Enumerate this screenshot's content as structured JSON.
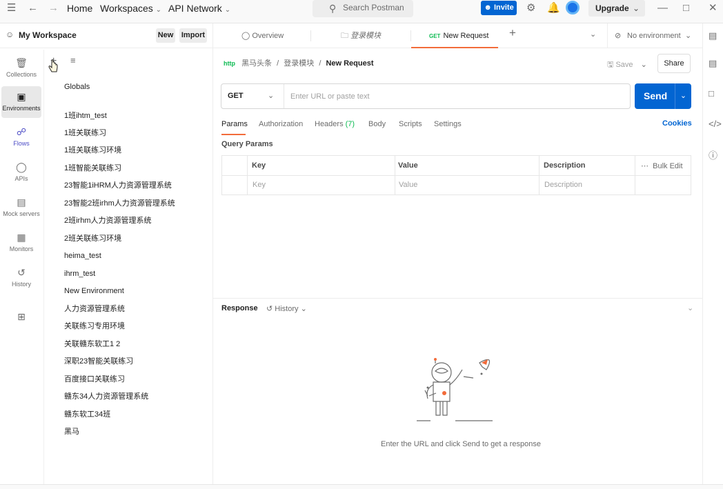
{
  "topbar": {
    "home": "Home",
    "workspaces": "Workspaces",
    "api_network": "API Network",
    "search_placeholder": "Search Postman",
    "invite": "Invite",
    "upgrade": "Upgrade"
  },
  "workspace": {
    "title": "My Workspace",
    "new_label": "New",
    "import_label": "Import"
  },
  "rail": {
    "items": [
      {
        "label": "Collections",
        "icon": "collections-icon"
      },
      {
        "label": "Environments",
        "icon": "environments-icon"
      },
      {
        "label": "Flows",
        "icon": "flows-icon"
      },
      {
        "label": "APIs",
        "icon": "apis-icon"
      },
      {
        "label": "Mock servers",
        "icon": "mock-servers-icon"
      },
      {
        "label": "Monitors",
        "icon": "monitors-icon"
      },
      {
        "label": "History",
        "icon": "history-icon"
      }
    ]
  },
  "environments": {
    "globals": "Globals",
    "items": [
      "1班ihtm_test",
      "1班关联练习",
      "1班关联练习环境",
      "1班智能关联练习",
      "23智能1iHRM人力资源管理系统",
      "23智能2班irhm人力资源管理系统",
      "2班irhm人力资源管理系统",
      "2班关联练习环境",
      "heima_test",
      "ihrm_test",
      "New Environment",
      "人力资源管理系统",
      "关联练习专用环境",
      "关联赣东软工1 2",
      "深职23智能关联练习",
      "百度接口关联练习",
      "赣东34人力资源管理系统",
      "赣东软工34班",
      "黑马"
    ]
  },
  "tabs": {
    "overview": "Overview",
    "folder": "登录模块",
    "request_method": "GET",
    "request_name": "New Request",
    "environment": "No environment"
  },
  "breadcrumb": {
    "collection": "黑马头条",
    "folder": "登录模块",
    "request": "New Request",
    "sep": "/"
  },
  "actions": {
    "save": "Save",
    "share": "Share",
    "send": "Send"
  },
  "url_bar": {
    "method": "GET",
    "placeholder": "Enter URL or paste text"
  },
  "request_tabs": [
    "Params",
    "Authorization",
    "Headers",
    "Body",
    "Scripts",
    "Settings"
  ],
  "headers_count": "(7)",
  "cookies": "Cookies",
  "query_params": {
    "title": "Query Params",
    "key": "Key",
    "value": "Value",
    "description": "Description",
    "bulk_edit": "Bulk Edit",
    "key_placeholder": "Key",
    "value_placeholder": "Value",
    "description_placeholder": "Description"
  },
  "response": {
    "title": "Response",
    "history": "History",
    "empty_message": "Enter the URL and click Send to get a response"
  },
  "colors": {
    "accent_orange": "#f26b3a",
    "brand_blue": "#0265d2",
    "get_green": "#0cbb52"
  }
}
